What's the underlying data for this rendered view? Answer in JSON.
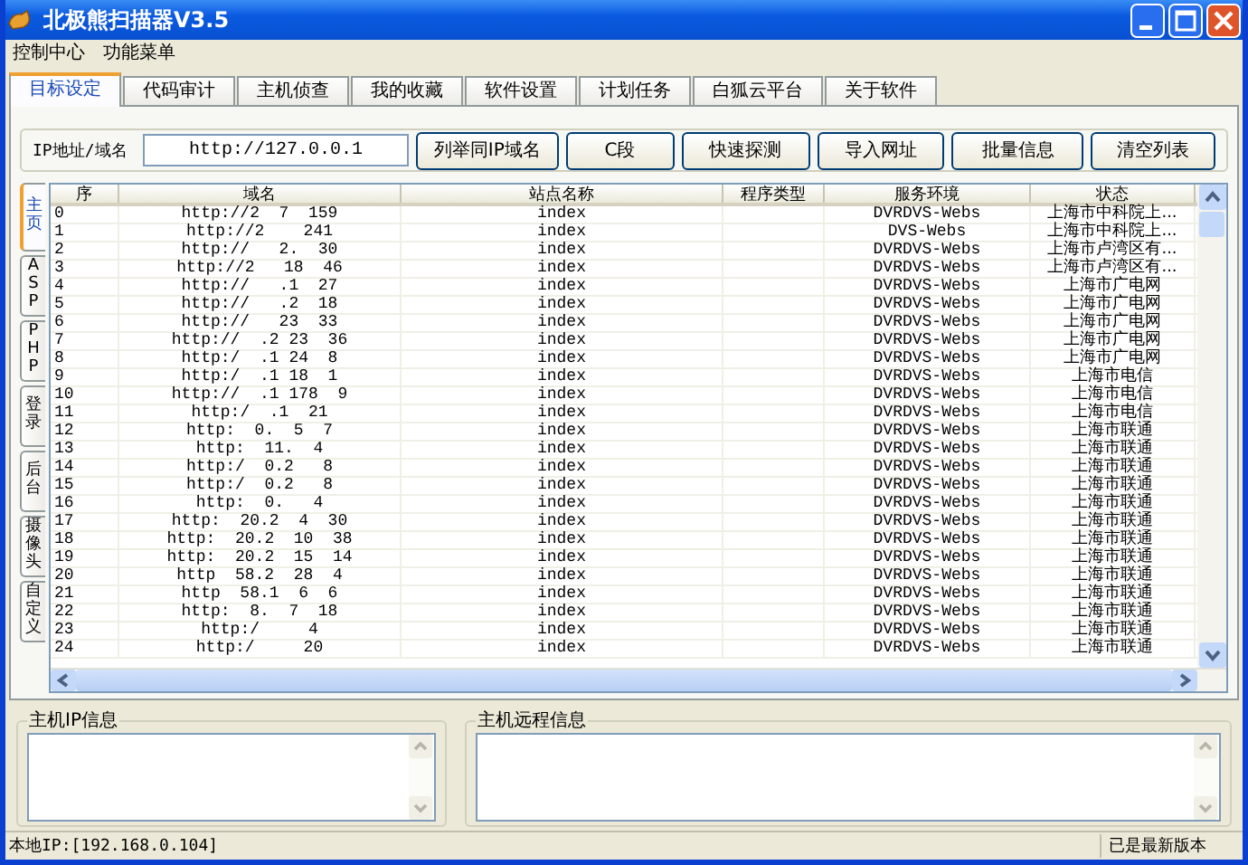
{
  "window": {
    "title": "北极熊扫描器V3.5"
  },
  "menu": [
    "控制中心",
    "功能菜单"
  ],
  "tabs": [
    {
      "label": "目标设定",
      "selected": true
    },
    {
      "label": "代码审计",
      "selected": false
    },
    {
      "label": "主机侦查",
      "selected": false
    },
    {
      "label": "我的收藏",
      "selected": false
    },
    {
      "label": "软件设置",
      "selected": false
    },
    {
      "label": "计划任务",
      "selected": false
    },
    {
      "label": "白狐云平台",
      "selected": false
    },
    {
      "label": "关于软件",
      "selected": false
    }
  ],
  "target": {
    "label": "IP地址/域名",
    "value": "http://127.0.0.1"
  },
  "buttons": [
    "列举同IP域名",
    "C段",
    "快速探测",
    "导入网址",
    "批量信息",
    "清空列表"
  ],
  "side_tabs": [
    {
      "label": "主页",
      "selected": true
    },
    {
      "label": "ASP",
      "selected": false
    },
    {
      "label": "PHP",
      "selected": false
    },
    {
      "label": "登录",
      "selected": false
    },
    {
      "label": "后台",
      "selected": false
    },
    {
      "label": "摄像头",
      "selected": false
    },
    {
      "label": "自定义",
      "selected": false
    }
  ],
  "table": {
    "columns": [
      "序",
      "域名",
      "站点名称",
      "程序类型",
      "服务环境",
      "状态"
    ],
    "rows": [
      {
        "no": "0",
        "domain": "http://2  7  159",
        "site": "index",
        "server": "DVRDVS-Webs",
        "status": "上海市中科院上..."
      },
      {
        "no": "1",
        "domain": "http://2    241",
        "site": "index",
        "server": "DVS-Webs",
        "status": "上海市中科院上..."
      },
      {
        "no": "2",
        "domain": "http://   2.  30",
        "site": "index",
        "server": "DVRDVS-Webs",
        "status": "上海市卢湾区有..."
      },
      {
        "no": "3",
        "domain": "http://2   18  46",
        "site": "index",
        "server": "DVRDVS-Webs",
        "status": "上海市卢湾区有..."
      },
      {
        "no": "4",
        "domain": "http://   .1  27",
        "site": "index",
        "server": "DVRDVS-Webs",
        "status": "上海市广电网"
      },
      {
        "no": "5",
        "domain": "http://   .2  18",
        "site": "index",
        "server": "DVRDVS-Webs",
        "status": "上海市广电网"
      },
      {
        "no": "6",
        "domain": "http://   23  33",
        "site": "index",
        "server": "DVRDVS-Webs",
        "status": "上海市广电网"
      },
      {
        "no": "7",
        "domain": "http://  .2 23  36",
        "site": "index",
        "server": "DVRDVS-Webs",
        "status": "上海市广电网"
      },
      {
        "no": "8",
        "domain": "http:/  .1 24  8",
        "site": "index",
        "server": "DVRDVS-Webs",
        "status": "上海市广电网"
      },
      {
        "no": "9",
        "domain": "http:/  .1 18  1",
        "site": "index",
        "server": "DVRDVS-Webs",
        "status": "上海市电信"
      },
      {
        "no": "10",
        "domain": "http://  .1 178  9",
        "site": "index",
        "server": "DVRDVS-Webs",
        "status": "上海市电信"
      },
      {
        "no": "11",
        "domain": "http:/  .1  21",
        "site": "index",
        "server": "DVRDVS-Webs",
        "status": "上海市电信"
      },
      {
        "no": "12",
        "domain": "http:  0.  5  7",
        "site": "index",
        "server": "DVRDVS-Webs",
        "status": "上海市联通"
      },
      {
        "no": "13",
        "domain": "http:  11.  4",
        "site": "index",
        "server": "DVRDVS-Webs",
        "status": "上海市联通"
      },
      {
        "no": "14",
        "domain": "http:/  0.2   8",
        "site": "index",
        "server": "DVRDVS-Webs",
        "status": "上海市联通"
      },
      {
        "no": "15",
        "domain": "http:/  0.2   8",
        "site": "index",
        "server": "DVRDVS-Webs",
        "status": "上海市联通"
      },
      {
        "no": "16",
        "domain": "http:  0.   4",
        "site": "index",
        "server": "DVRDVS-Webs",
        "status": "上海市联通"
      },
      {
        "no": "17",
        "domain": "http:  20.2  4  30",
        "site": "index",
        "server": "DVRDVS-Webs",
        "status": "上海市联通"
      },
      {
        "no": "18",
        "domain": "http:  20.2  10  38",
        "site": "index",
        "server": "DVRDVS-Webs",
        "status": "上海市联通"
      },
      {
        "no": "19",
        "domain": "http:  20.2  15  14",
        "site": "index",
        "server": "DVRDVS-Webs",
        "status": "上海市联通"
      },
      {
        "no": "20",
        "domain": "http  58.2  28  4",
        "site": "index",
        "server": "DVRDVS-Webs",
        "status": "上海市联通"
      },
      {
        "no": "21",
        "domain": "http  58.1  6  6",
        "site": "index",
        "server": "DVRDVS-Webs",
        "status": "上海市联通"
      },
      {
        "no": "22",
        "domain": "http:  8.  7  18",
        "site": "index",
        "server": "DVRDVS-Webs",
        "status": "上海市联通"
      },
      {
        "no": "23",
        "domain": "http:/     4",
        "site": "index",
        "server": "DVRDVS-Webs",
        "status": "上海市联通"
      },
      {
        "no": "24",
        "domain": "http:/     20",
        "site": "index",
        "server": "DVRDVS-Webs",
        "status": "上海市联通"
      }
    ]
  },
  "panels": [
    {
      "title": "主机IP信息"
    },
    {
      "title": "主机远程信息"
    }
  ],
  "status_bar": {
    "local_ip": "本地IP:[192.168.0.104]",
    "version": "已是最新版本"
  }
}
